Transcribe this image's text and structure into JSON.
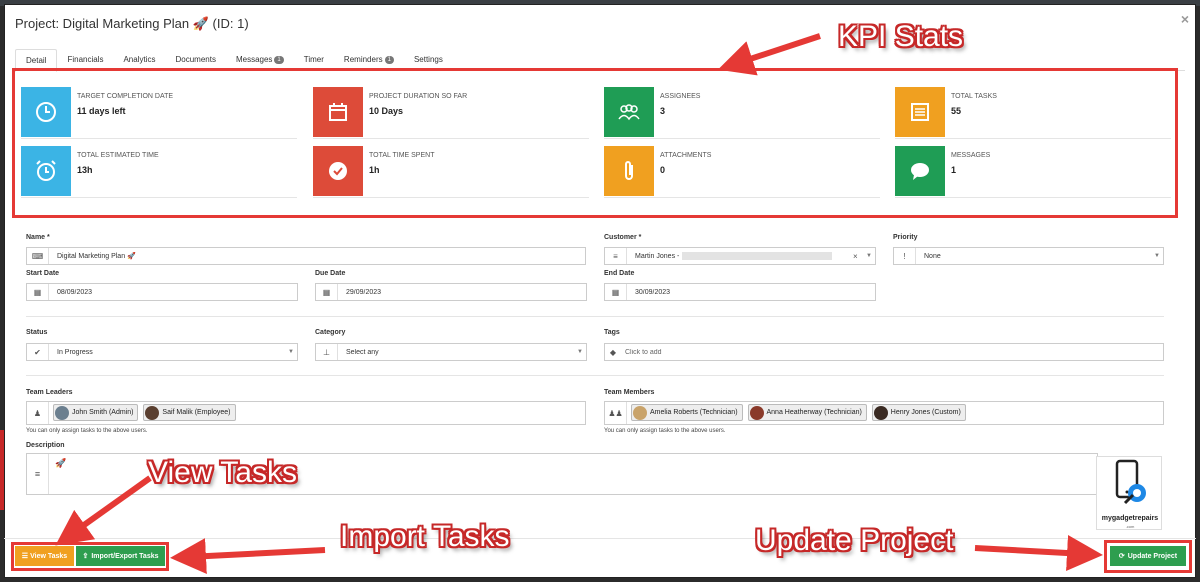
{
  "modal": {
    "title": "Project: Digital Marketing Plan 🚀 (ID: 1)",
    "close": "×"
  },
  "tabs": [
    {
      "label": "Detail",
      "active": true
    },
    {
      "label": "Financials"
    },
    {
      "label": "Analytics"
    },
    {
      "label": "Documents"
    },
    {
      "label": "Messages",
      "badge": "1"
    },
    {
      "label": "Timer"
    },
    {
      "label": "Reminders",
      "badge": "1"
    },
    {
      "label": "Settings"
    }
  ],
  "kpis": [
    {
      "label": "TARGET COMPLETION DATE",
      "value": "11 days left",
      "color": "#3bb4e5",
      "icon": "clock-icon"
    },
    {
      "label": "PROJECT DURATION SO FAR",
      "value": "10 Days",
      "color": "#dd4b39",
      "icon": "calendar-icon"
    },
    {
      "label": "ASSIGNEES",
      "value": "3",
      "color": "#1f9d55",
      "icon": "users-icon"
    },
    {
      "label": "TOTAL TASKS",
      "value": "55",
      "color": "#f0a020",
      "icon": "list-icon"
    },
    {
      "label": "TOTAL ESTIMATED TIME",
      "value": "13h",
      "color": "#3bb4e5",
      "icon": "alarm-icon"
    },
    {
      "label": "TOTAL TIME SPENT",
      "value": "1h",
      "color": "#dd4b39",
      "icon": "check-icon"
    },
    {
      "label": "ATTACHMENTS",
      "value": "0",
      "color": "#f0a020",
      "icon": "paperclip-icon"
    },
    {
      "label": "MESSAGES",
      "value": "1",
      "color": "#1f9d55",
      "icon": "chat-icon"
    }
  ],
  "form": {
    "name_label": "Name *",
    "name_value": "Digital Marketing Plan 🚀",
    "customer_label": "Customer *",
    "customer_value": "Martin Jones -",
    "customer_clear": "×",
    "priority_label": "Priority",
    "priority_value": "None",
    "start_label": "Start Date",
    "start_value": "08/09/2023",
    "due_label": "Due Date",
    "due_value": "29/09/2023",
    "end_label": "End Date",
    "end_value": "30/09/2023",
    "status_label": "Status",
    "status_value": "In Progress",
    "category_label": "Category",
    "category_value": "Select any",
    "tags_label": "Tags",
    "tags_placeholder": "Click to add",
    "leaders_label": "Team Leaders",
    "leaders": [
      "John Smith (Admin)",
      "Saif Malik (Employee)"
    ],
    "members_label": "Team Members",
    "members": [
      "Amelia Roberts (Technician)",
      "Anna Heatherway (Technician)",
      "Henry Jones (Custom)"
    ],
    "assign_help": "You can only assign tasks to the above users.",
    "description_label": "Description",
    "description_value": "🚀"
  },
  "buttons": {
    "view_tasks": "View Tasks",
    "import_export": "Import/Export Tasks",
    "update": "Update Project"
  },
  "callouts": {
    "kpi": "KPI Stats",
    "view": "View Tasks",
    "import": "Import Tasks",
    "update": "Update Project"
  },
  "logo": {
    "text": "mygadgetrepairs",
    "sub": ".com"
  },
  "colors": {
    "green_button": "#2e9e4f",
    "orange_button": "#f0a020",
    "highlight": "#e53935"
  }
}
